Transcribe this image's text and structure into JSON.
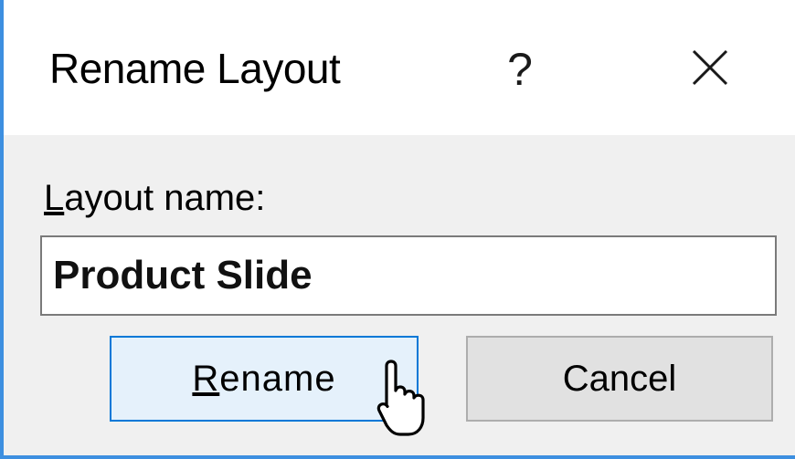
{
  "dialog": {
    "title": "Rename Layout",
    "help_label": "?",
    "close_icon": "close-icon"
  },
  "field": {
    "label_mnemonic": "L",
    "label_rest": "ayout name:",
    "value": "Product Slide"
  },
  "buttons": {
    "rename": {
      "mnemonic": "R",
      "rest": "ename"
    },
    "cancel": {
      "label": "Cancel"
    }
  },
  "pointer": {
    "icon": "hand-cursor-icon"
  },
  "colors": {
    "accent_border": "#3d8fe0",
    "default_button_border": "#0078d7",
    "default_button_fill": "#e5f1fb",
    "button_fill": "#e1e1e1",
    "dialog_background": "#f0f0f0"
  }
}
